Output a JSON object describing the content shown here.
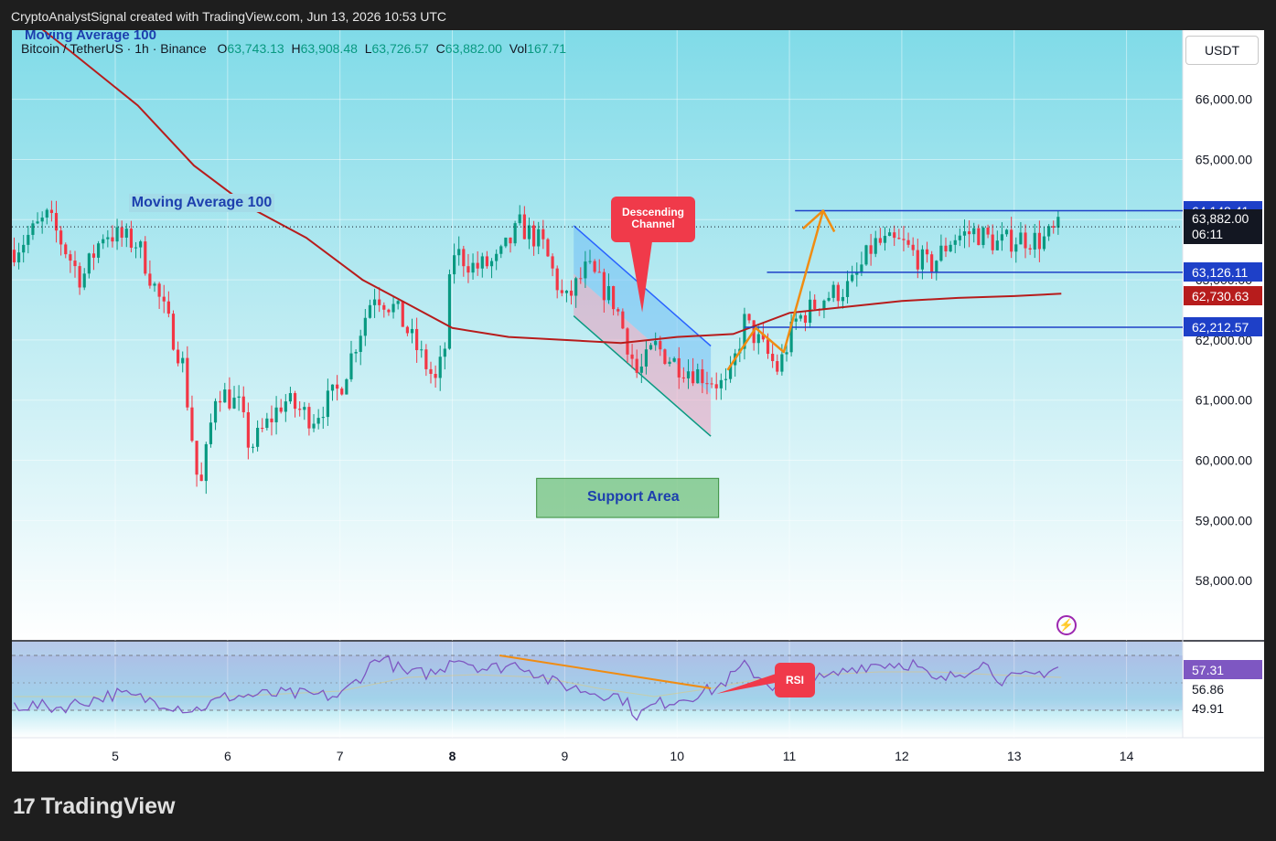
{
  "header": {
    "text": "CryptoAnalystSignal created with TradingView.com, Jun 13, 2026 10:53 UTC"
  },
  "legend": {
    "ma_title": "Moving Average 100",
    "symbol": "Bitcoin / TetherUS · 1h · Binance",
    "open_label": "O",
    "open": "63,743.13",
    "high_label": "H",
    "high": "63,908.48",
    "low_label": "L",
    "low": "63,726.57",
    "close_label": "C",
    "close": "63,882.00",
    "vol_label": "Vol",
    "vol": "167.71"
  },
  "currency_button": "USDT",
  "price_tags": {
    "level_high": "64,148.41",
    "current_price": "63,882.00",
    "countdown": "06:11",
    "level_mid": "63,126.11",
    "ma_value": "62,730.63",
    "level_low": "62,212.57"
  },
  "rsi_tags": {
    "rsi": "57.31",
    "ma": "56.86",
    "smoothed": "49.91"
  },
  "annotations": {
    "ma_label": "Moving Average 100",
    "channel_callout": "Descending Channel",
    "support_label": "Support Area",
    "rsi_callout": "RSI"
  },
  "footer": {
    "brand": "TradingView",
    "logo_mark": "17"
  },
  "colors": {
    "up": "#089981",
    "down": "#f23645",
    "ma": "#b71c1c",
    "levels": "#1e40c8",
    "rsi_line": "#7e57c2",
    "background_top": "#7fdbe8",
    "callout": "#f03a4a",
    "arrow": "#f08c12"
  },
  "chart_data": [
    {
      "type": "candlestick",
      "title": "",
      "xlabel": "",
      "ylabel": "",
      "x_ticks": [
        "5",
        "6",
        "7",
        "8",
        "9",
        "10",
        "11",
        "12",
        "13",
        "14"
      ],
      "y_ticks": [
        "58,000.00",
        "59,000.00",
        "60,000.00",
        "61,000.00",
        "62,000.00",
        "63,000.00",
        "64,000.00",
        "65,000.00",
        "66,000.00"
      ],
      "ylim": [
        57000,
        67150
      ],
      "xlim": [
        4.08,
        14.5
      ],
      "price_anchors": [
        [
          4.1,
          63500
        ],
        [
          4.4,
          64050
        ],
        [
          4.7,
          63000
        ],
        [
          4.9,
          63800
        ],
        [
          5.2,
          63600
        ],
        [
          5.45,
          62400
        ],
        [
          5.6,
          61600
        ],
        [
          5.75,
          59400
        ],
        [
          5.9,
          61200
        ],
        [
          6.1,
          60900
        ],
        [
          6.2,
          60200
        ],
        [
          6.5,
          61000
        ],
        [
          6.75,
          60700
        ],
        [
          7.0,
          61200
        ],
        [
          7.3,
          62800
        ],
        [
          7.5,
          62500
        ],
        [
          7.7,
          61800
        ],
        [
          7.85,
          61300
        ],
        [
          7.93,
          61800
        ],
        [
          8.0,
          63500
        ],
        [
          8.2,
          63200
        ],
        [
          8.4,
          63300
        ],
        [
          8.6,
          63900
        ],
        [
          8.8,
          63600
        ],
        [
          9.0,
          62600
        ],
        [
          9.2,
          63200
        ],
        [
          9.45,
          62600
        ],
        [
          9.65,
          61400
        ],
        [
          9.8,
          61900
        ],
        [
          10.0,
          61600
        ],
        [
          10.25,
          61400
        ],
        [
          10.45,
          61200
        ],
        [
          10.6,
          62300
        ],
        [
          10.75,
          61900
        ],
        [
          10.9,
          61500
        ],
        [
          11.05,
          62300
        ],
        [
          11.3,
          62700
        ],
        [
          11.55,
          62900
        ],
        [
          11.75,
          63600
        ],
        [
          12.0,
          63600
        ],
        [
          12.25,
          63200
        ],
        [
          12.45,
          63700
        ],
        [
          12.65,
          63800
        ],
        [
          12.85,
          63600
        ],
        [
          13.05,
          63700
        ],
        [
          13.25,
          63650
        ],
        [
          13.42,
          63882
        ]
      ],
      "moving_average_100": [
        [
          4.12,
          67500
        ],
        [
          4.6,
          66800
        ],
        [
          5.2,
          65900
        ],
        [
          5.7,
          64900
        ],
        [
          6.2,
          64200
        ],
        [
          6.7,
          63700
        ],
        [
          7.2,
          63000
        ],
        [
          7.6,
          62600
        ],
        [
          8.0,
          62200
        ],
        [
          8.5,
          62050
        ],
        [
          9.0,
          62000
        ],
        [
          9.5,
          61950
        ],
        [
          10.0,
          62050
        ],
        [
          10.5,
          62100
        ],
        [
          11.0,
          62450
        ],
        [
          11.5,
          62550
        ],
        [
          12.0,
          62650
        ],
        [
          12.5,
          62700
        ],
        [
          13.0,
          62730
        ],
        [
          13.42,
          62770
        ]
      ],
      "horizontal_levels": [
        {
          "price": 64148.41,
          "x_from": 11.05,
          "x_to": 14.5
        },
        {
          "price": 63126.11,
          "x_from": 10.8,
          "x_to": 14.5
        },
        {
          "price": 62212.57,
          "x_from": 10.6,
          "x_to": 14.5
        }
      ],
      "current_price": 63882.0,
      "descending_channel": {
        "upper": [
          [
            9.08,
            63900
          ],
          [
            10.3,
            61900
          ]
        ],
        "mid": [
          [
            9.08,
            63100
          ],
          [
            10.3,
            61100
          ]
        ],
        "lower": [
          [
            9.08,
            62400
          ],
          [
            10.3,
            60400
          ]
        ]
      },
      "support_zone": {
        "x": [
          8.75,
          10.37
        ],
        "price": [
          59050,
          59700
        ]
      },
      "projection_arrow": [
        [
          10.45,
          61500
        ],
        [
          10.7,
          62200
        ],
        [
          10.95,
          61800
        ],
        [
          11.3,
          64150
        ],
        [
          11.4,
          63800
        ]
      ]
    },
    {
      "type": "line",
      "title": "",
      "ylim": [
        40,
        75
      ],
      "levels": [
        70,
        50
      ],
      "rsi_anchors": [
        [
          4.1,
          52
        ],
        [
          4.5,
          51
        ],
        [
          5.0,
          56
        ],
        [
          5.4,
          53
        ],
        [
          5.7,
          50
        ],
        [
          6.0,
          55
        ],
        [
          6.5,
          56
        ],
        [
          7.0,
          55
        ],
        [
          7.2,
          63
        ],
        [
          7.35,
          70
        ],
        [
          7.6,
          63
        ],
        [
          7.9,
          64
        ],
        [
          8.0,
          70
        ],
        [
          8.3,
          65
        ],
        [
          8.6,
          67
        ],
        [
          8.9,
          60
        ],
        [
          9.2,
          57
        ],
        [
          9.5,
          55
        ],
        [
          9.65,
          48
        ],
        [
          9.8,
          52
        ],
        [
          10.1,
          55
        ],
        [
          10.35,
          58
        ],
        [
          10.6,
          66
        ],
        [
          10.85,
          59
        ],
        [
          11.05,
          63
        ],
        [
          11.3,
          61
        ],
        [
          11.6,
          66
        ],
        [
          11.8,
          67
        ],
        [
          12.1,
          67
        ],
        [
          12.3,
          60
        ],
        [
          12.55,
          64
        ],
        [
          12.7,
          68
        ],
        [
          12.9,
          61
        ],
        [
          13.1,
          62
        ],
        [
          13.42,
          66
        ]
      ],
      "rsi_ma_anchors": [
        [
          4.1,
          55
        ],
        [
          5.0,
          55
        ],
        [
          6.0,
          55
        ],
        [
          7.0,
          57
        ],
        [
          7.6,
          62
        ],
        [
          8.2,
          63
        ],
        [
          8.8,
          62
        ],
        [
          9.3,
          58
        ],
        [
          9.8,
          55
        ],
        [
          10.3,
          58
        ],
        [
          10.8,
          62
        ],
        [
          11.3,
          63
        ],
        [
          11.8,
          64
        ],
        [
          12.3,
          64
        ],
        [
          12.8,
          63
        ],
        [
          13.42,
          62
        ]
      ],
      "divergence_line": [
        [
          8.42,
          70
        ],
        [
          10.3,
          58
        ]
      ],
      "rsi_arrow": [
        [
          10.35,
          56
        ],
        [
          11.0,
          63
        ]
      ]
    }
  ]
}
